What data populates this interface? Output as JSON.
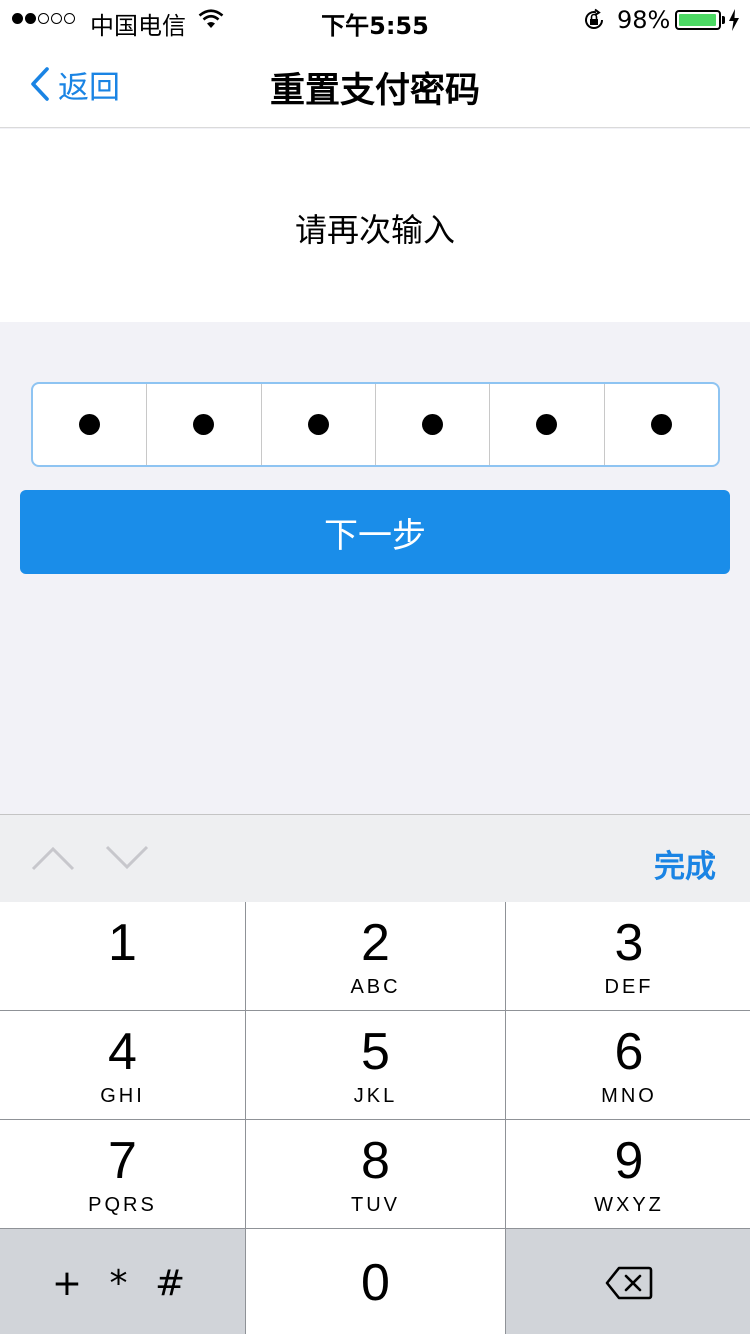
{
  "status_bar": {
    "carrier": "中国电信",
    "time": "下午5:55",
    "battery_percent": "98%",
    "battery_level": 0.98,
    "signal_bars_filled": 2,
    "signal_bars_total": 5
  },
  "nav": {
    "back_label": "返回",
    "title": "重置支付密码"
  },
  "prompt": {
    "text": "请再次输入"
  },
  "pin": {
    "length": 6,
    "entered": 6
  },
  "next_button": {
    "label": "下一步"
  },
  "accessory": {
    "done_label": "完成"
  },
  "keypad": {
    "keys": [
      {
        "num": "1",
        "letters": ""
      },
      {
        "num": "2",
        "letters": "ABC"
      },
      {
        "num": "3",
        "letters": "DEF"
      },
      {
        "num": "4",
        "letters": "GHI"
      },
      {
        "num": "5",
        "letters": "JKL"
      },
      {
        "num": "6",
        "letters": "MNO"
      },
      {
        "num": "7",
        "letters": "PQRS"
      },
      {
        "num": "8",
        "letters": "TUV"
      },
      {
        "num": "9",
        "letters": "WXYZ"
      }
    ],
    "symbols_label": "+ * #",
    "zero": "0"
  },
  "colors": {
    "accent": "#1a84e4",
    "button": "#1a8de9",
    "battery": "#4cd964"
  }
}
